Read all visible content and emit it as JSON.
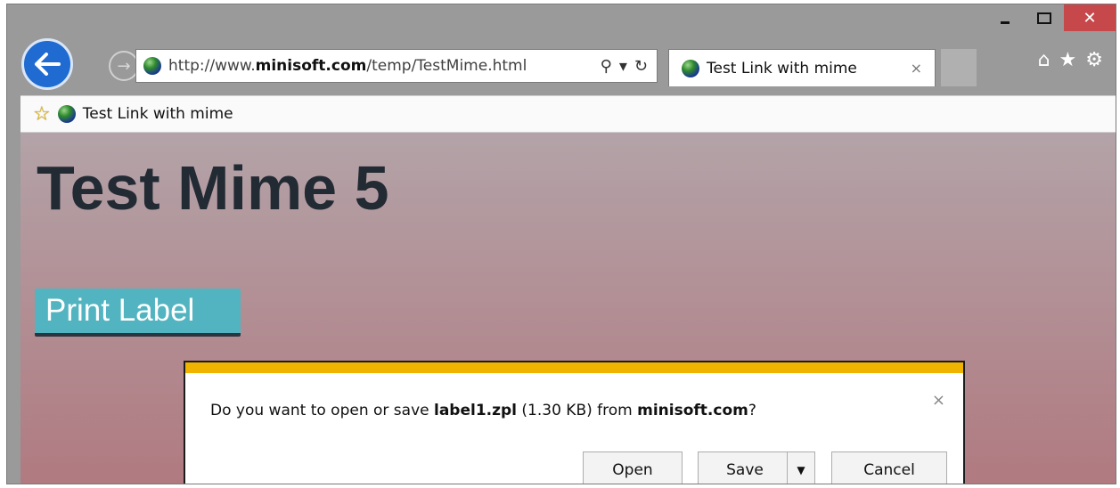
{
  "window": {
    "caption_min": "",
    "caption_max": "",
    "caption_close": "✕"
  },
  "nav": {
    "back_icon": "←",
    "forward_icon": "→"
  },
  "address_bar": {
    "url_prefix": "http://www.",
    "url_domain": "minisoft.com",
    "url_path": "/temp/TestMime.html",
    "search_icon": "⚲",
    "dropdown_icon": "▾",
    "refresh_icon": "↻"
  },
  "tab": {
    "title": "Test Link with mime",
    "close": "×"
  },
  "toolbar_icons": {
    "home": "⌂",
    "favorites": "★",
    "settings": "⚙"
  },
  "favorites_bar": {
    "add_icon": "☆",
    "link_label": "Test Link with mime"
  },
  "page": {
    "title": "Test Mime 5",
    "print_button": "Print Label"
  },
  "notification": {
    "msg_prefix": "Do you want to open or save ",
    "filename": "label1.zpl",
    "msg_mid": " (1.30 KB) from ",
    "source": "minisoft.com",
    "msg_suffix": "?",
    "close": "×",
    "open_label": "Open",
    "save_label": "Save",
    "save_arrow": "▼",
    "cancel_label": "Cancel"
  }
}
